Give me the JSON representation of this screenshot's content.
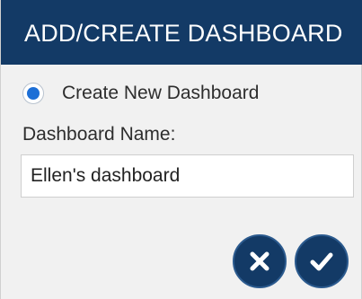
{
  "dialog": {
    "title": "ADD/CREATE DASHBOARD",
    "option_label": "Create New Dashboard",
    "option_selected": true,
    "name_label": "Dashboard Name:",
    "name_value": "Ellen's dashboard"
  },
  "buttons": {
    "cancel_icon": "close-icon",
    "confirm_icon": "checkmark-icon"
  },
  "colors": {
    "titlebar": "#133a66",
    "accent": "#1d6fd6",
    "background": "#f1f1f1"
  }
}
